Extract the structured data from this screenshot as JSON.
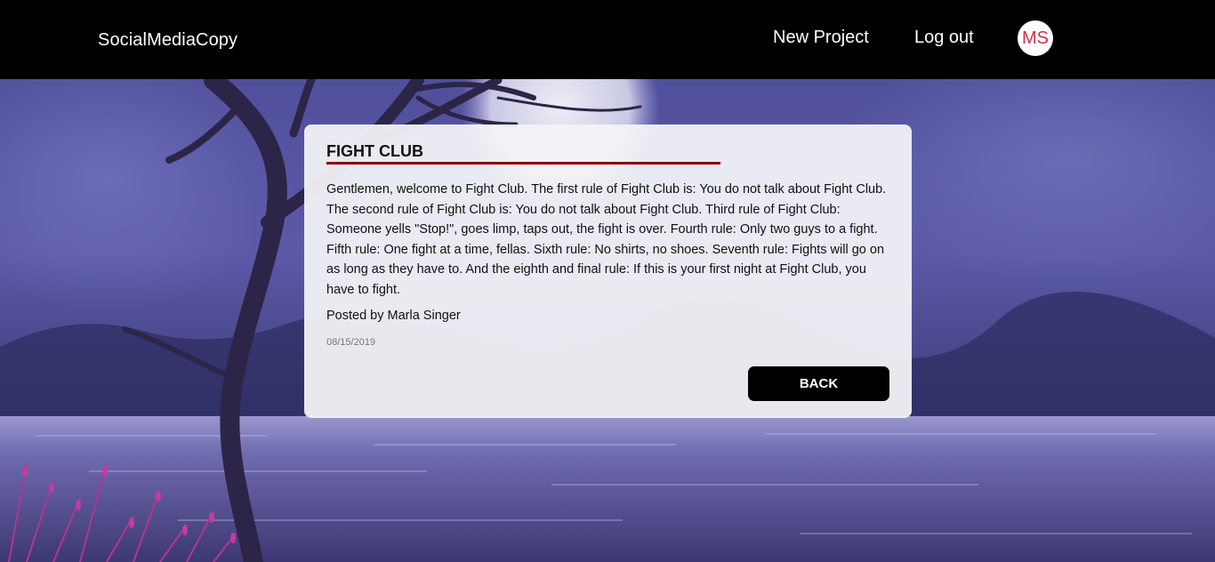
{
  "navbar": {
    "brand": "SocialMediaCopy",
    "links": {
      "new_project": "New Project",
      "log_out": "Log out"
    },
    "avatar_initials": "MS"
  },
  "post": {
    "title": "FIGHT CLUB",
    "body": "Gentlemen, welcome to Fight Club. The first rule of Fight Club is: You do not talk about Fight Club. The second rule of Fight Club is: You do not talk about Fight Club. Third rule of Fight Club: Someone yells \"Stop!\", goes limp, taps out, the fight is over. Fourth rule: Only two guys to a fight. Fifth rule: One fight at a time, fellas. Sixth rule: No shirts, no shoes. Seventh rule: Fights will go on as long as they have to. And the eighth and final rule: If this is your first night at Fight Club, you have to fight.",
    "author": "Posted by Marla Singer",
    "date": "08/15/2019",
    "back_label": "BACK"
  },
  "colors": {
    "navbar_bg": "#000000",
    "title_underline": "#8b0000",
    "avatar_text": "#d2304a",
    "button_bg": "#000000"
  }
}
